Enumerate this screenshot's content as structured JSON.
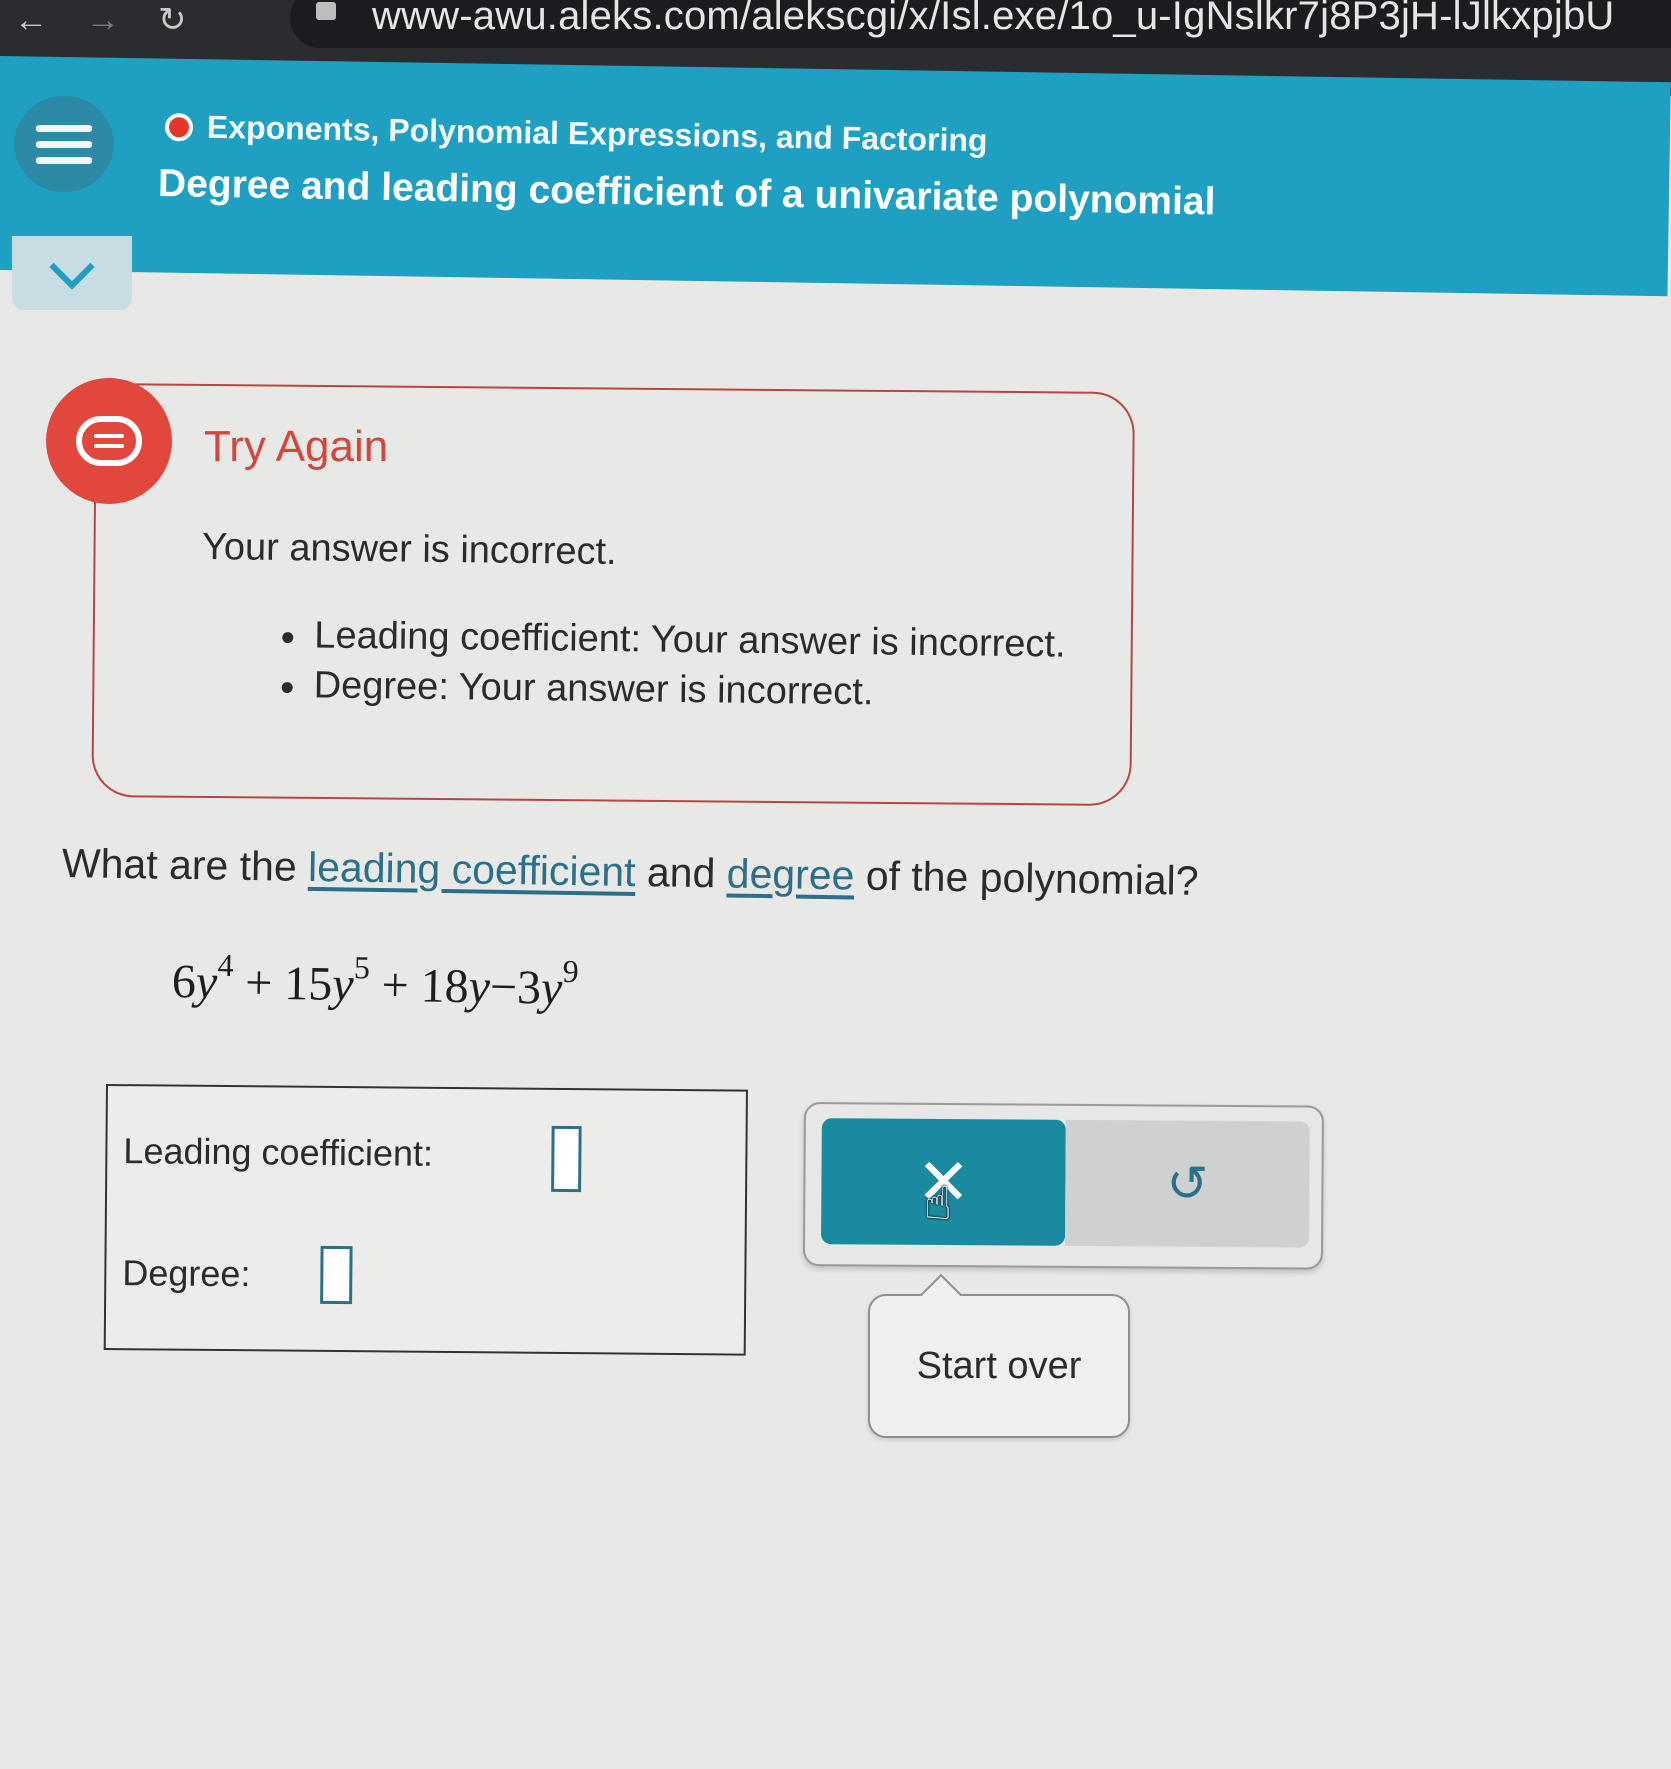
{
  "browser": {
    "back_icon": "back-arrow-icon",
    "forward_icon": "forward-arrow-icon",
    "reload_icon": "reload-icon",
    "url": "www-awu.aleks.com/alekscgi/x/Isl.exe/1o_u-IgNslkr7j8P3jH-lJlkxpjbU"
  },
  "header": {
    "menu_icon": "hamburger-menu-icon",
    "course_status_color": "#e4362b",
    "course_title": "Exponents, Polynomial Expressions, and Factoring",
    "topic_title": "Degree and leading coefficient of a univariate polynomial",
    "collapse_icon": "chevron-down-icon"
  },
  "feedback": {
    "icon": "chat-bubble-icon",
    "title": "Try Again",
    "message": "Your answer is incorrect.",
    "items": [
      "Leading coefficient: Your answer is incorrect.",
      "Degree: Your answer is incorrect."
    ]
  },
  "question": {
    "prefix": "What are the ",
    "link1": "leading coefficient",
    "middle": " and ",
    "link2": "degree",
    "suffix": " of the polynomial?"
  },
  "polynomial": {
    "t1_coef": "6",
    "t1_var": "y",
    "t1_exp": "4",
    "op1": "+",
    "t2_coef": "15",
    "t2_var": "y",
    "t2_exp": "5",
    "op2": "+",
    "t3_coef": "18",
    "t3_var": "y",
    "op3": "−",
    "t4_coef": "3",
    "t4_var": "y",
    "t4_exp": "9"
  },
  "answer": {
    "leading_label": "Leading coefficient:",
    "leading_value": "",
    "degree_label": "Degree:",
    "degree_value": ""
  },
  "controls": {
    "clear_icon": "x-icon",
    "undo_icon": "undo-icon",
    "tooltip": "Start over"
  },
  "colors": {
    "header_bg": "#1f9fc1",
    "feedback_accent": "#d2463b",
    "primary_button": "#1b8aa1",
    "link": "#2b6f8a"
  }
}
